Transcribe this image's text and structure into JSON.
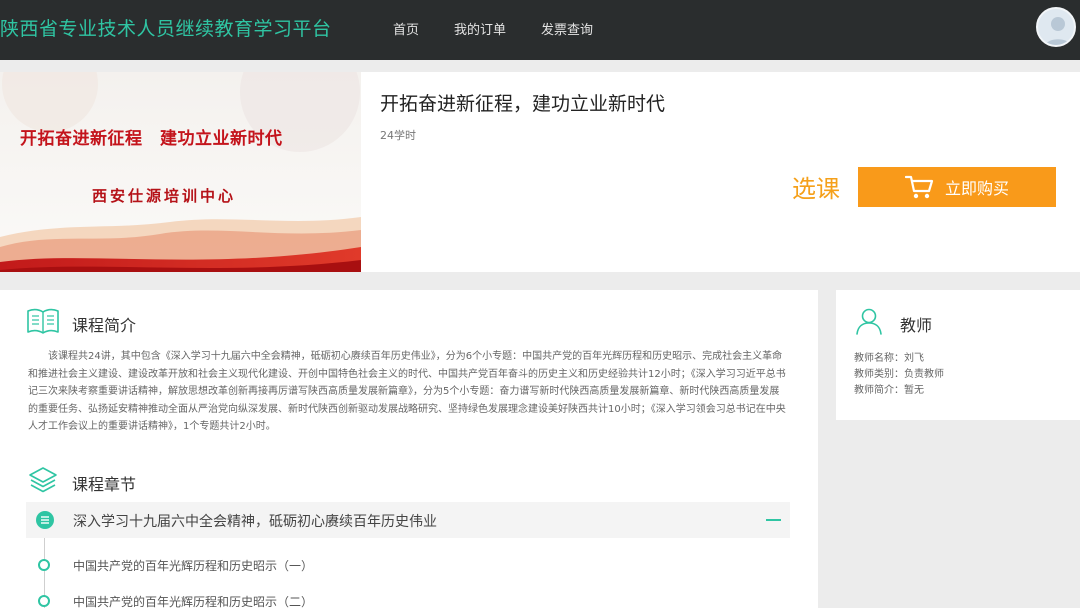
{
  "header": {
    "site_title": "陕西省专业技术人员继续教育学习平台",
    "nav": [
      "首页",
      "我的订单",
      "发票查询"
    ]
  },
  "banner": {
    "headline": "开拓奋进新征程　建功立业新时代",
    "org": "西安仕源培训中心"
  },
  "course": {
    "title": "开拓奋进新征程，建功立业新时代",
    "hours": "24学时",
    "select_label": "选课",
    "buy_label": "立即购买"
  },
  "intro": {
    "heading": "课程简介",
    "text": "该课程共24讲，其中包含《深入学习十九届六中全会精神，砥砺初心赓续百年历史伟业》，分为6个小专题：中国共产党的百年光辉历程和历史昭示、完成社会主义革命和推进社会主义建设、建设改革开放和社会主义现代化建设、开创中国特色社会主义的时代、中国共产党百年奋斗的历史主义和历史经验共计12小时；《深入学习习近平总书记三次来陕考察重要讲话精神，解放思想改革创新再接再厉谱写陕西高质量发展新篇章》，分为5个小专题：奋力谱写新时代陕西高质量发展新篇章、新时代陕西高质量发展的重要任务、弘扬延安精神推动全面从严治党向纵深发展、新时代陕西创新驱动发展战略研究、坚持绿色发展理念建设美好陕西共计10小时；《深入学习领会习总书记在中央人才工作会议上的重要讲话精神》，1个专题共计2小时。"
  },
  "chapters": {
    "heading": "课程章节",
    "items": [
      {
        "title": "深入学习十九届六中全会精神，砥砺初心赓续百年历史伟业",
        "lessons": [
          "中国共产党的百年光辉历程和历史昭示（一）",
          "中国共产党的百年光辉历程和历史昭示（二）"
        ]
      }
    ]
  },
  "teacher": {
    "heading": "教师",
    "name_row": "教师名称：刘飞",
    "type_row": "教师类别：负责教师",
    "bio_row": "教师简介：暂无"
  },
  "colors": {
    "accent": "#2fc5a3",
    "buy": "#f99a1a",
    "header_bg": "#2a2d2e"
  },
  "icons": [
    "cart-icon",
    "book-icon",
    "layers-icon",
    "list-icon",
    "collapse-icon",
    "user-outline-icon",
    "avatar"
  ]
}
